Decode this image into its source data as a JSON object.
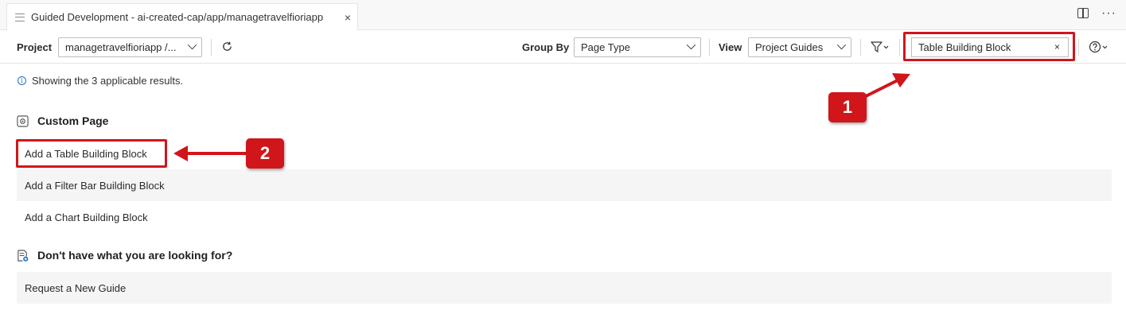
{
  "tab": {
    "title": "Guided Development - ai-created-cap/app/managetravelfioriapp",
    "close_glyph": "×"
  },
  "tabbar_actions": {
    "split_icon": "split-editor-icon",
    "more_glyph": "···"
  },
  "toolbar": {
    "project_label": "Project",
    "project_value": "managetravelfioriapp /...",
    "group_by_label": "Group By",
    "group_by_value": "Page Type",
    "view_label": "View",
    "view_value": "Project Guides",
    "search_value": "Table Building Block",
    "search_clear": "×"
  },
  "info": {
    "icon_glyph": "i",
    "text": "Showing the 3 applicable results."
  },
  "sections": [
    {
      "title": "Custom Page",
      "items": [
        "Add a Table Building Block",
        "Add a Filter Bar Building Block",
        "Add a Chart Building Block"
      ]
    },
    {
      "title": "Don't have what you are looking for?",
      "items": [
        "Request a New Guide"
      ]
    }
  ],
  "annotations": {
    "callout_1": "1",
    "callout_2": "2",
    "color": "#d1161b"
  }
}
